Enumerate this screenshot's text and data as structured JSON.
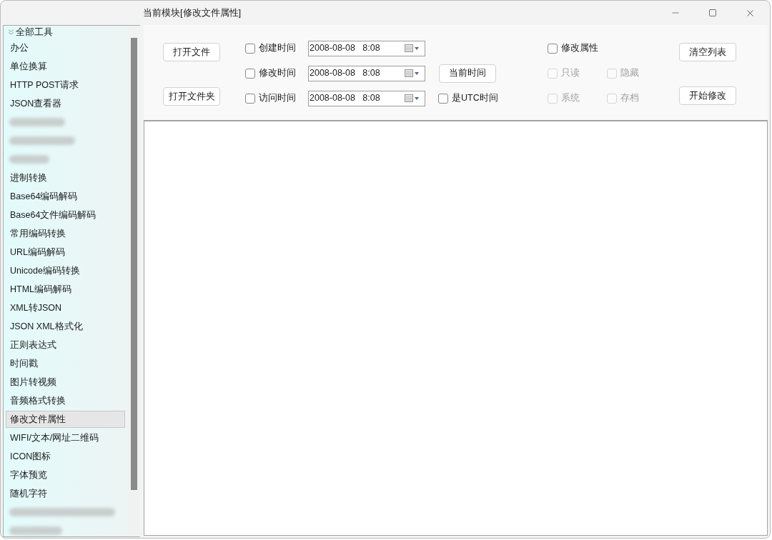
{
  "window": {
    "title": "当前模块[修改文件属性]"
  },
  "sidebar": {
    "groups": [
      {
        "label": "全部工具",
        "expanded": true,
        "children": [
          {
            "kind": "tool",
            "label": "办公",
            "selected": false
          },
          {
            "kind": "tool",
            "label": "单位换算",
            "selected": false
          },
          {
            "kind": "tool",
            "label": "HTTP POST请求",
            "selected": false
          },
          {
            "kind": "tool",
            "label": "JSON查看器",
            "selected": false
          },
          {
            "kind": "redacted",
            "selected": false
          },
          {
            "kind": "redacted",
            "selected": false
          },
          {
            "kind": "redacted",
            "selected": false
          },
          {
            "kind": "tool",
            "label": "进制转换",
            "selected": false
          },
          {
            "kind": "tool",
            "label": "Base64编码解码",
            "selected": false
          },
          {
            "kind": "tool",
            "label": "Base64文件编码解码",
            "selected": false
          },
          {
            "kind": "tool",
            "label": "常用编码转换",
            "selected": false
          },
          {
            "kind": "tool",
            "label": "URL编码解码",
            "selected": false
          },
          {
            "kind": "tool",
            "label": "Unicode编码转换",
            "selected": false
          },
          {
            "kind": "tool",
            "label": "HTML编码解码",
            "selected": false
          },
          {
            "kind": "tool",
            "label": "XML转JSON",
            "selected": false
          },
          {
            "kind": "tool",
            "label": "JSON XML格式化",
            "selected": false
          },
          {
            "kind": "tool",
            "label": "正则表达式",
            "selected": false
          },
          {
            "kind": "tool",
            "label": "时间戳",
            "selected": false
          },
          {
            "kind": "tool",
            "label": "图片转视频",
            "selected": false
          },
          {
            "kind": "tool",
            "label": "音频格式转换",
            "selected": false
          },
          {
            "kind": "tool",
            "label": "修改文件属性",
            "selected": true
          },
          {
            "kind": "tool",
            "label": "WIFI/文本/网址二维码",
            "selected": false
          },
          {
            "kind": "tool",
            "label": "ICON图标",
            "selected": false
          },
          {
            "kind": "tool",
            "label": "字体预览",
            "selected": false
          },
          {
            "kind": "tool",
            "label": "随机字符",
            "selected": false
          },
          {
            "kind": "redacted",
            "selected": false
          },
          {
            "kind": "redacted",
            "selected": false
          }
        ]
      }
    ]
  },
  "file_buttons": [
    {
      "label": "打开文件"
    },
    {
      "label": "打开文件夹"
    }
  ],
  "time_fields": [
    {
      "label": "创建时间",
      "checked": false,
      "value": "2008-08-08   8:08"
    },
    {
      "label": "修改时间",
      "checked": false,
      "value": "2008-08-08   8:08"
    },
    {
      "label": "访问时间",
      "checked": false,
      "value": "2008-08-08   8:08"
    }
  ],
  "current_time_button": {
    "label": "当前时间"
  },
  "utc_option": {
    "label": "是UTC时间",
    "checked": false
  },
  "modify_attributes": {
    "label": "修改属性",
    "checked": false
  },
  "attributes": [
    {
      "label": "只读",
      "checked": false,
      "disabled": true
    },
    {
      "label": "隐藏",
      "checked": false,
      "disabled": true
    },
    {
      "label": "系统",
      "checked": false,
      "disabled": true
    },
    {
      "label": "存档",
      "checked": false,
      "disabled": true
    }
  ],
  "action_buttons": [
    {
      "label": "清空列表"
    },
    {
      "label": "开始修改"
    }
  ]
}
